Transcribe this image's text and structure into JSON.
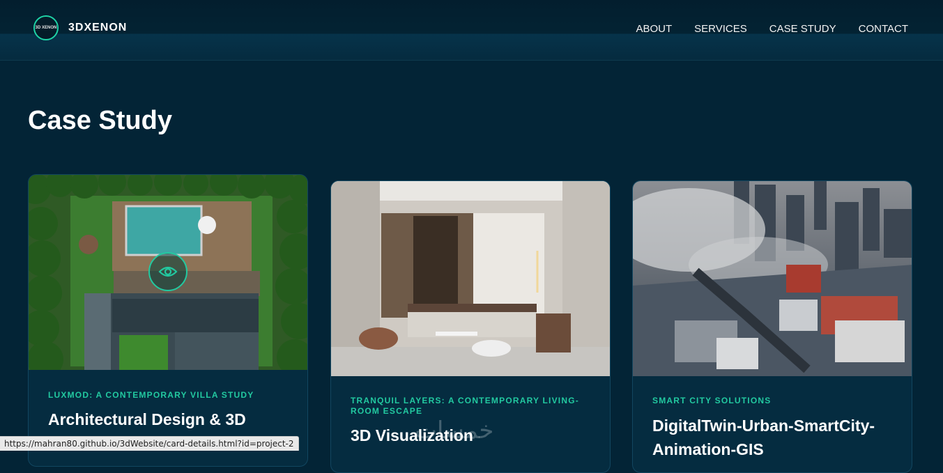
{
  "header": {
    "logo_badge": "3D XENON",
    "brand": "3DXENON",
    "nav": [
      "ABOUT",
      "SERVICES",
      "CASE STUDY",
      "CONTACT"
    ]
  },
  "main": {
    "title": "Case Study",
    "cards": [
      {
        "category": "LUXMOD: A CONTEMPORARY VILLA STUDY",
        "title": "Architectural Design & 3D Visualization",
        "image": "aerial-villa-pool-render"
      },
      {
        "category": "TRANQUIL LAYERS: A CONTEMPORARY LIVING-ROOM ESCAPE",
        "title": "3D Visualization",
        "image": "living-room-interior-render"
      },
      {
        "category": "SMART CITY SOLUTIONS",
        "title": "DigitalTwin-Urban-SmartCity-Animation-GIS",
        "image": "aerial-smart-city-render"
      }
    ]
  },
  "overlay": {
    "watermark": "خمسات"
  },
  "status_bar": {
    "url": "https://mahran80.github.io/3dWebsite/card-details.html?id=project-2"
  },
  "colors": {
    "accent": "#22c9a0",
    "background": "#032436",
    "card": "#052c40"
  }
}
